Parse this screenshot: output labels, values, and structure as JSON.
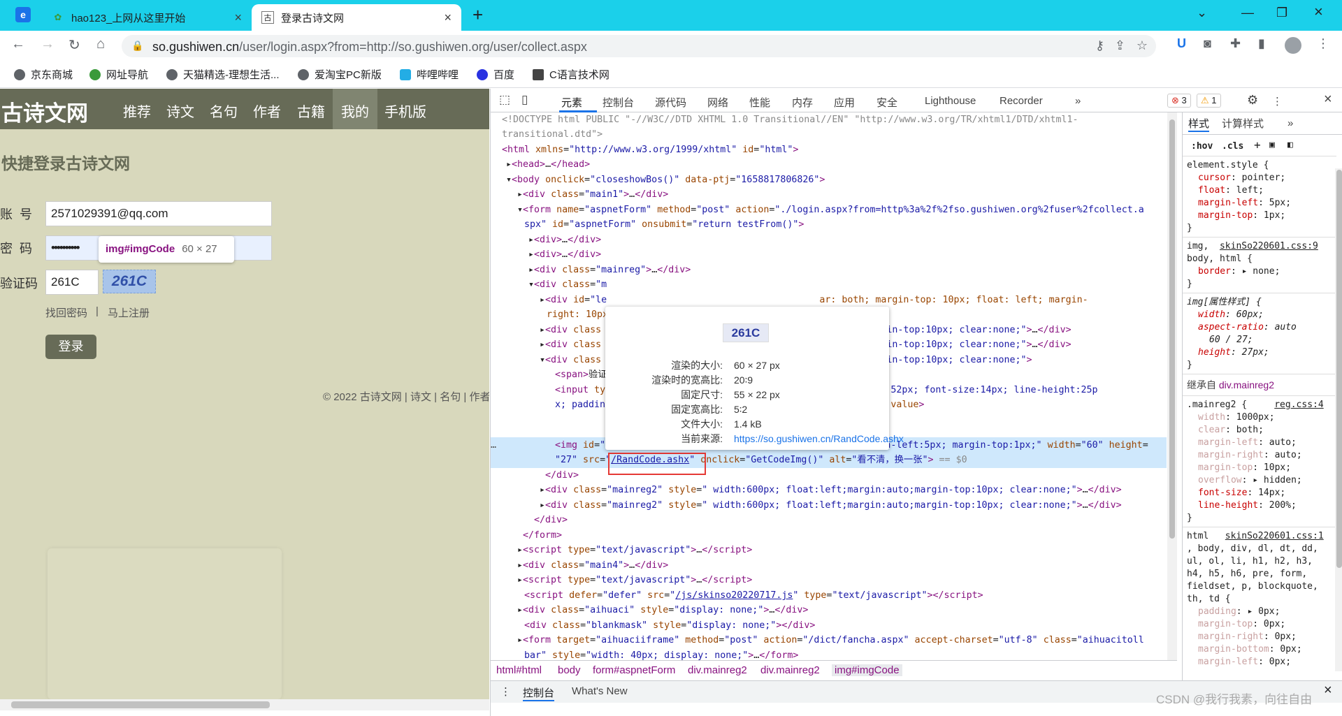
{
  "browser": {
    "tabs": [
      {
        "title": "hao123_上网从这里开始",
        "active": false
      },
      {
        "title": "登录古诗文网",
        "active": true
      }
    ],
    "url_host": "so.gushiwen.cn",
    "url_path": "/user/login.aspx?from=http://so.gushiwen.org/user/collect.aspx",
    "bookmarks": [
      "京东商城",
      "网址导航",
      "天猫精选-理想生活...",
      "爱淘宝PC新版",
      "哔哩哔哩",
      "百度",
      "C语言技术网"
    ]
  },
  "page": {
    "logo": "古诗文网",
    "nav": [
      "推荐",
      "诗文",
      "名句",
      "作者",
      "古籍",
      "我的",
      "手机版"
    ],
    "nav_selected": "我的",
    "title": "快捷登录古诗文网",
    "labels": {
      "account": "账  号",
      "password": "密  码",
      "code": "验证码"
    },
    "account_value": "2571029391@qq.com",
    "password_value": "••••••••••",
    "code_value": "261C",
    "captcha_text": "261C",
    "tooltip_selector": "img#imgCode",
    "tooltip_size": "60 × 27",
    "link_forgot": "找回密码",
    "link_sep": "|",
    "link_register": "马上注册",
    "login_button": "登录",
    "footer": "© 2022 古诗文网 | 诗文 | 名句 | 作者"
  },
  "devtools": {
    "tabs": [
      "元素",
      "控制台",
      "源代码",
      "网络",
      "性能",
      "内存",
      "应用",
      "安全",
      "Lighthouse",
      "Recorder"
    ],
    "error_count": "3",
    "warn_count": "1",
    "popup": {
      "thumb_text": "261C",
      "rows": [
        {
          "k": "渲染的大小:",
          "v": "60 × 27 px"
        },
        {
          "k": "渲染时的宽高比:",
          "v": "20∶9"
        },
        {
          "k": "固定尺寸:",
          "v": "55 × 22 px"
        },
        {
          "k": "固定宽高比:",
          "v": "5∶2"
        },
        {
          "k": "文件大小:",
          "v": "1.4 kB"
        },
        {
          "k": "当前来源:",
          "v": "https://so.gushiwen.cn/RandCode.ashx"
        }
      ]
    },
    "breadcrumbs": [
      "html#html",
      "body",
      "form#aspnetForm",
      "div.mainreg2",
      "div.mainreg2",
      "img#imgCode"
    ],
    "drawer_tabs": [
      "控制台",
      "What's New"
    ],
    "styles_tabs": [
      "样式",
      "计算样式"
    ],
    "filter_hov": ":hov",
    "filter_cls": ".cls",
    "inherited_label": "继承自",
    "inherited_from": "div.mainreg2",
    "watermark": "CSDN @我行我素，向往自由"
  }
}
